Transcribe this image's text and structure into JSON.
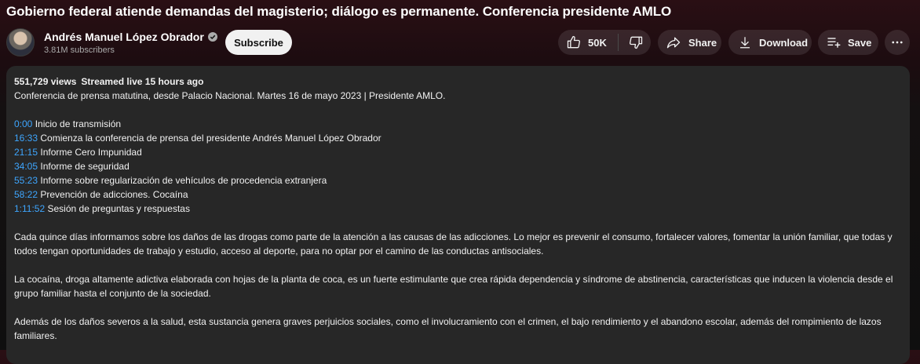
{
  "video": {
    "title": "Gobierno federal atiende demandas del magisterio; diálogo es permanente. Conferencia presidente AMLO"
  },
  "channel": {
    "name": "Andrés Manuel López Obrador",
    "subscribers": "3.81M subscribers",
    "verified_icon": "verified-check-icon",
    "subscribe_label": "Subscribe"
  },
  "actions": {
    "like_count": "50K",
    "share_label": "Share",
    "download_label": "Download",
    "save_label": "Save"
  },
  "description": {
    "views": "551,729 views",
    "streamed": "Streamed live 15 hours ago",
    "summary": "Conferencia de prensa matutina, desde Palacio Nacional. Martes 16 de mayo 2023 | Presidente AMLO.",
    "chapters": [
      {
        "time": "0:00",
        "title": "Inicio de transmisión"
      },
      {
        "time": "16:33",
        "title": "Comienza la conferencia de prensa del presidente Andrés Manuel López Obrador"
      },
      {
        "time": "21:15",
        "title": "Informe Cero Impunidad"
      },
      {
        "time": "34:05",
        "title": "Informe de seguridad"
      },
      {
        "time": "55:23",
        "title": "Informe sobre regularización de vehículos de procedencia extranjera"
      },
      {
        "time": "58:22",
        "title": "Prevención de adicciones. Cocaína"
      },
      {
        "time": "1:11:52",
        "title": "Sesión de preguntas y respuestas"
      }
    ],
    "paragraphs": [
      "Cada quince días informamos sobre los daños de las drogas como parte de la atención a las causas de las adicciones. Lo mejor es prevenir el consumo, fortalecer valores, fomentar la unión familiar, que todas y todos tengan oportunidades de trabajo y estudio, acceso al deporte, para no optar por el camino de las conductas antisociales.",
      "La cocaína, droga altamente adictiva elaborada con hojas de la planta de coca, es un fuerte estimulante que crea rápida dependencia y síndrome de abstinencia, características que inducen la violencia desde el grupo familiar hasta el conjunto de la sociedad.",
      "Además de los daños severos a la salud, esta sustancia genera graves perjuicios sociales, como el involucramiento con el crimen, el bajo rendimiento y el abandono escolar, además del rompimiento de lazos familiares."
    ]
  },
  "colors": {
    "timestamp_link": "#3ea6ff",
    "description_bg": "#272727",
    "subscribe_bg": "#f1f1f1"
  }
}
